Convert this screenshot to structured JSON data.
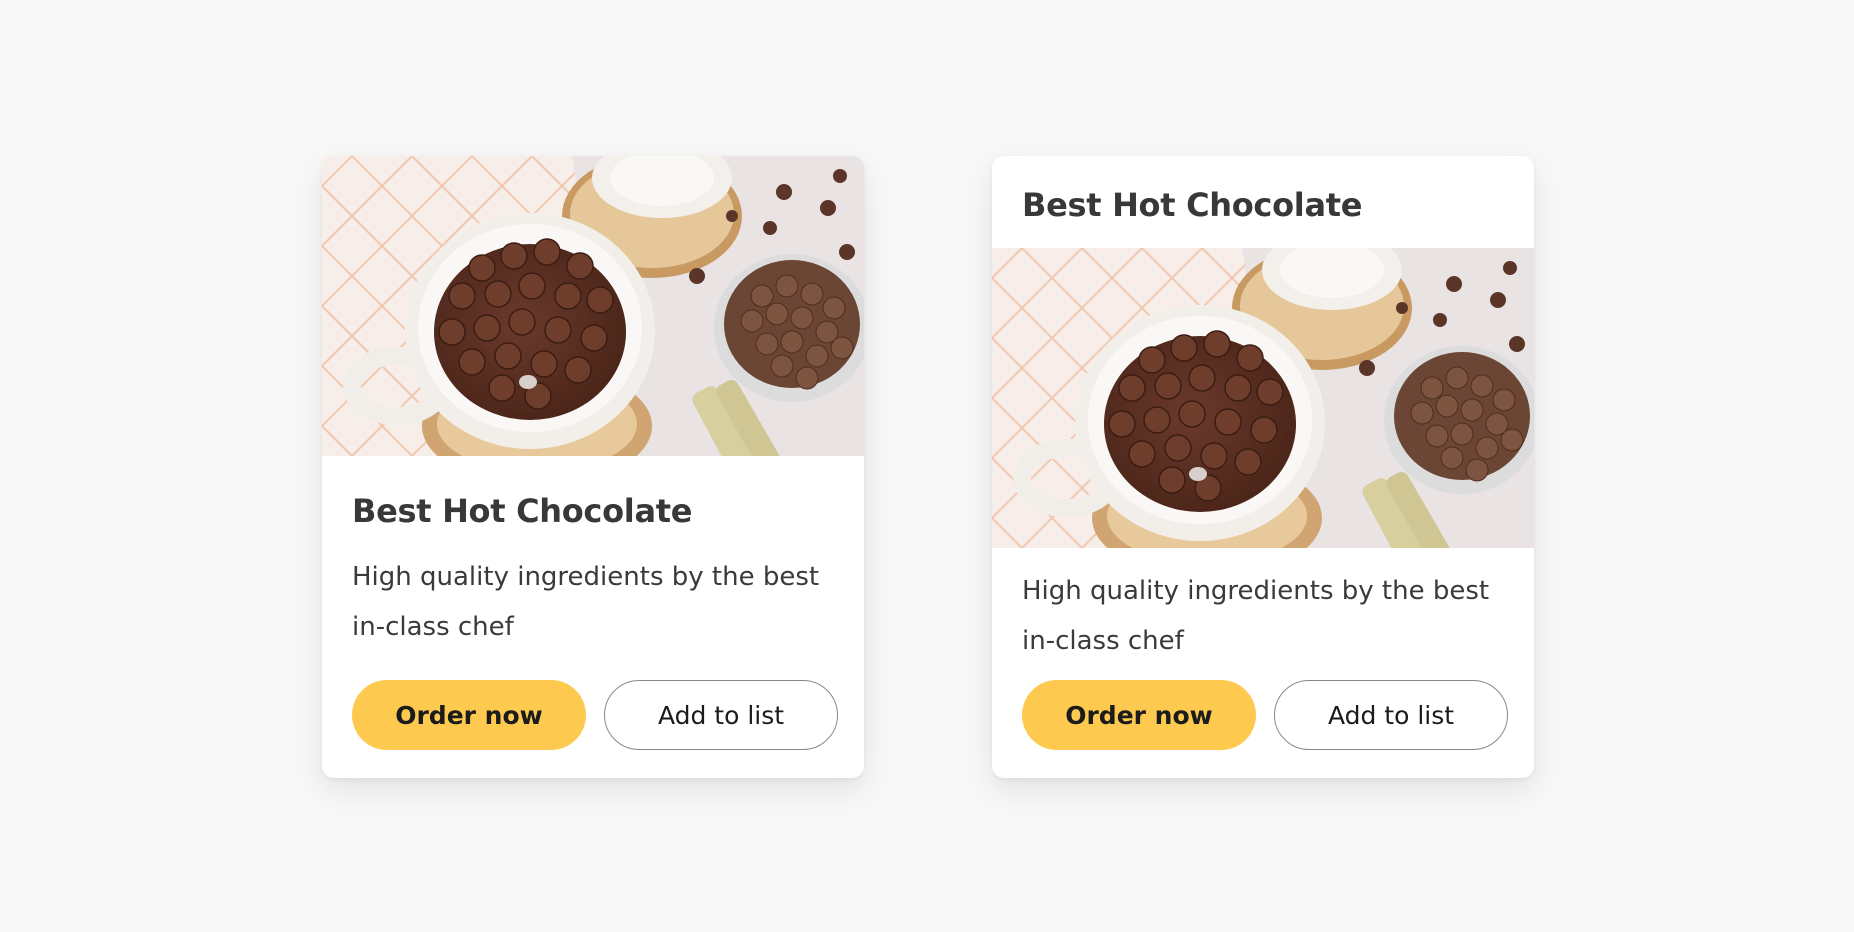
{
  "colors": {
    "page_background": "#f8f8f8",
    "card_background": "#ffffff",
    "primary_button": "#fdc94f",
    "secondary_button_border": "#888888",
    "title_text": "#383838"
  },
  "cards": [
    {
      "title": "Best Hot Chocolate",
      "description": "High quality ingredients by the best in-class chef",
      "image": "hot-chocolate-photo",
      "primary_label": "Order now",
      "secondary_label": "Add to list"
    },
    {
      "title": "Best Hot Chocolate",
      "description": "High quality ingredients by the best in-class chef",
      "image": "hot-chocolate-photo",
      "primary_label": "Order now",
      "secondary_label": "Add to list"
    }
  ]
}
